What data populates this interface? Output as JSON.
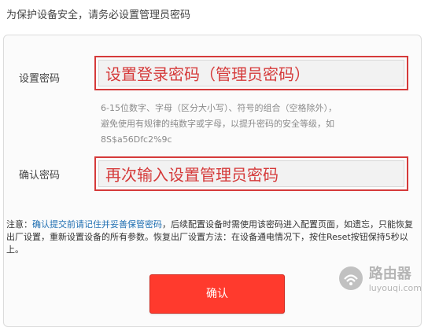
{
  "page": {
    "top_title": "为保护设备安全，请务必设置管理员密码"
  },
  "form": {
    "set_password": {
      "label": "设置密码",
      "overlay_text": "设置登录密码（管理员密码）"
    },
    "hint_lines": [
      "6-15位数字、字母（区分大小写）、符号的组合（空格除外），",
      "避免使用有规律的纯数字或字母，以提升密码的安全等级，如",
      "8S$a56Dfc2%9c"
    ],
    "confirm_password": {
      "label": "确认密码",
      "overlay_text": "再次输入设置管理员密码"
    }
  },
  "note": {
    "prefix": "注意：",
    "link_text": "确认提交前请记住并妥善保管密码",
    "rest": "，后续配置设备时需使用该密码进入配置页面，如遗忘，只能恢复出厂设置，重新设置设备的所有参数。恢复出厂设置方法：在设备通电情况下，按住Reset按钮保持5秒以上。"
  },
  "buttons": {
    "confirm": "确认"
  },
  "watermark": {
    "big": "路由器",
    "small": "luyouqi.com"
  }
}
